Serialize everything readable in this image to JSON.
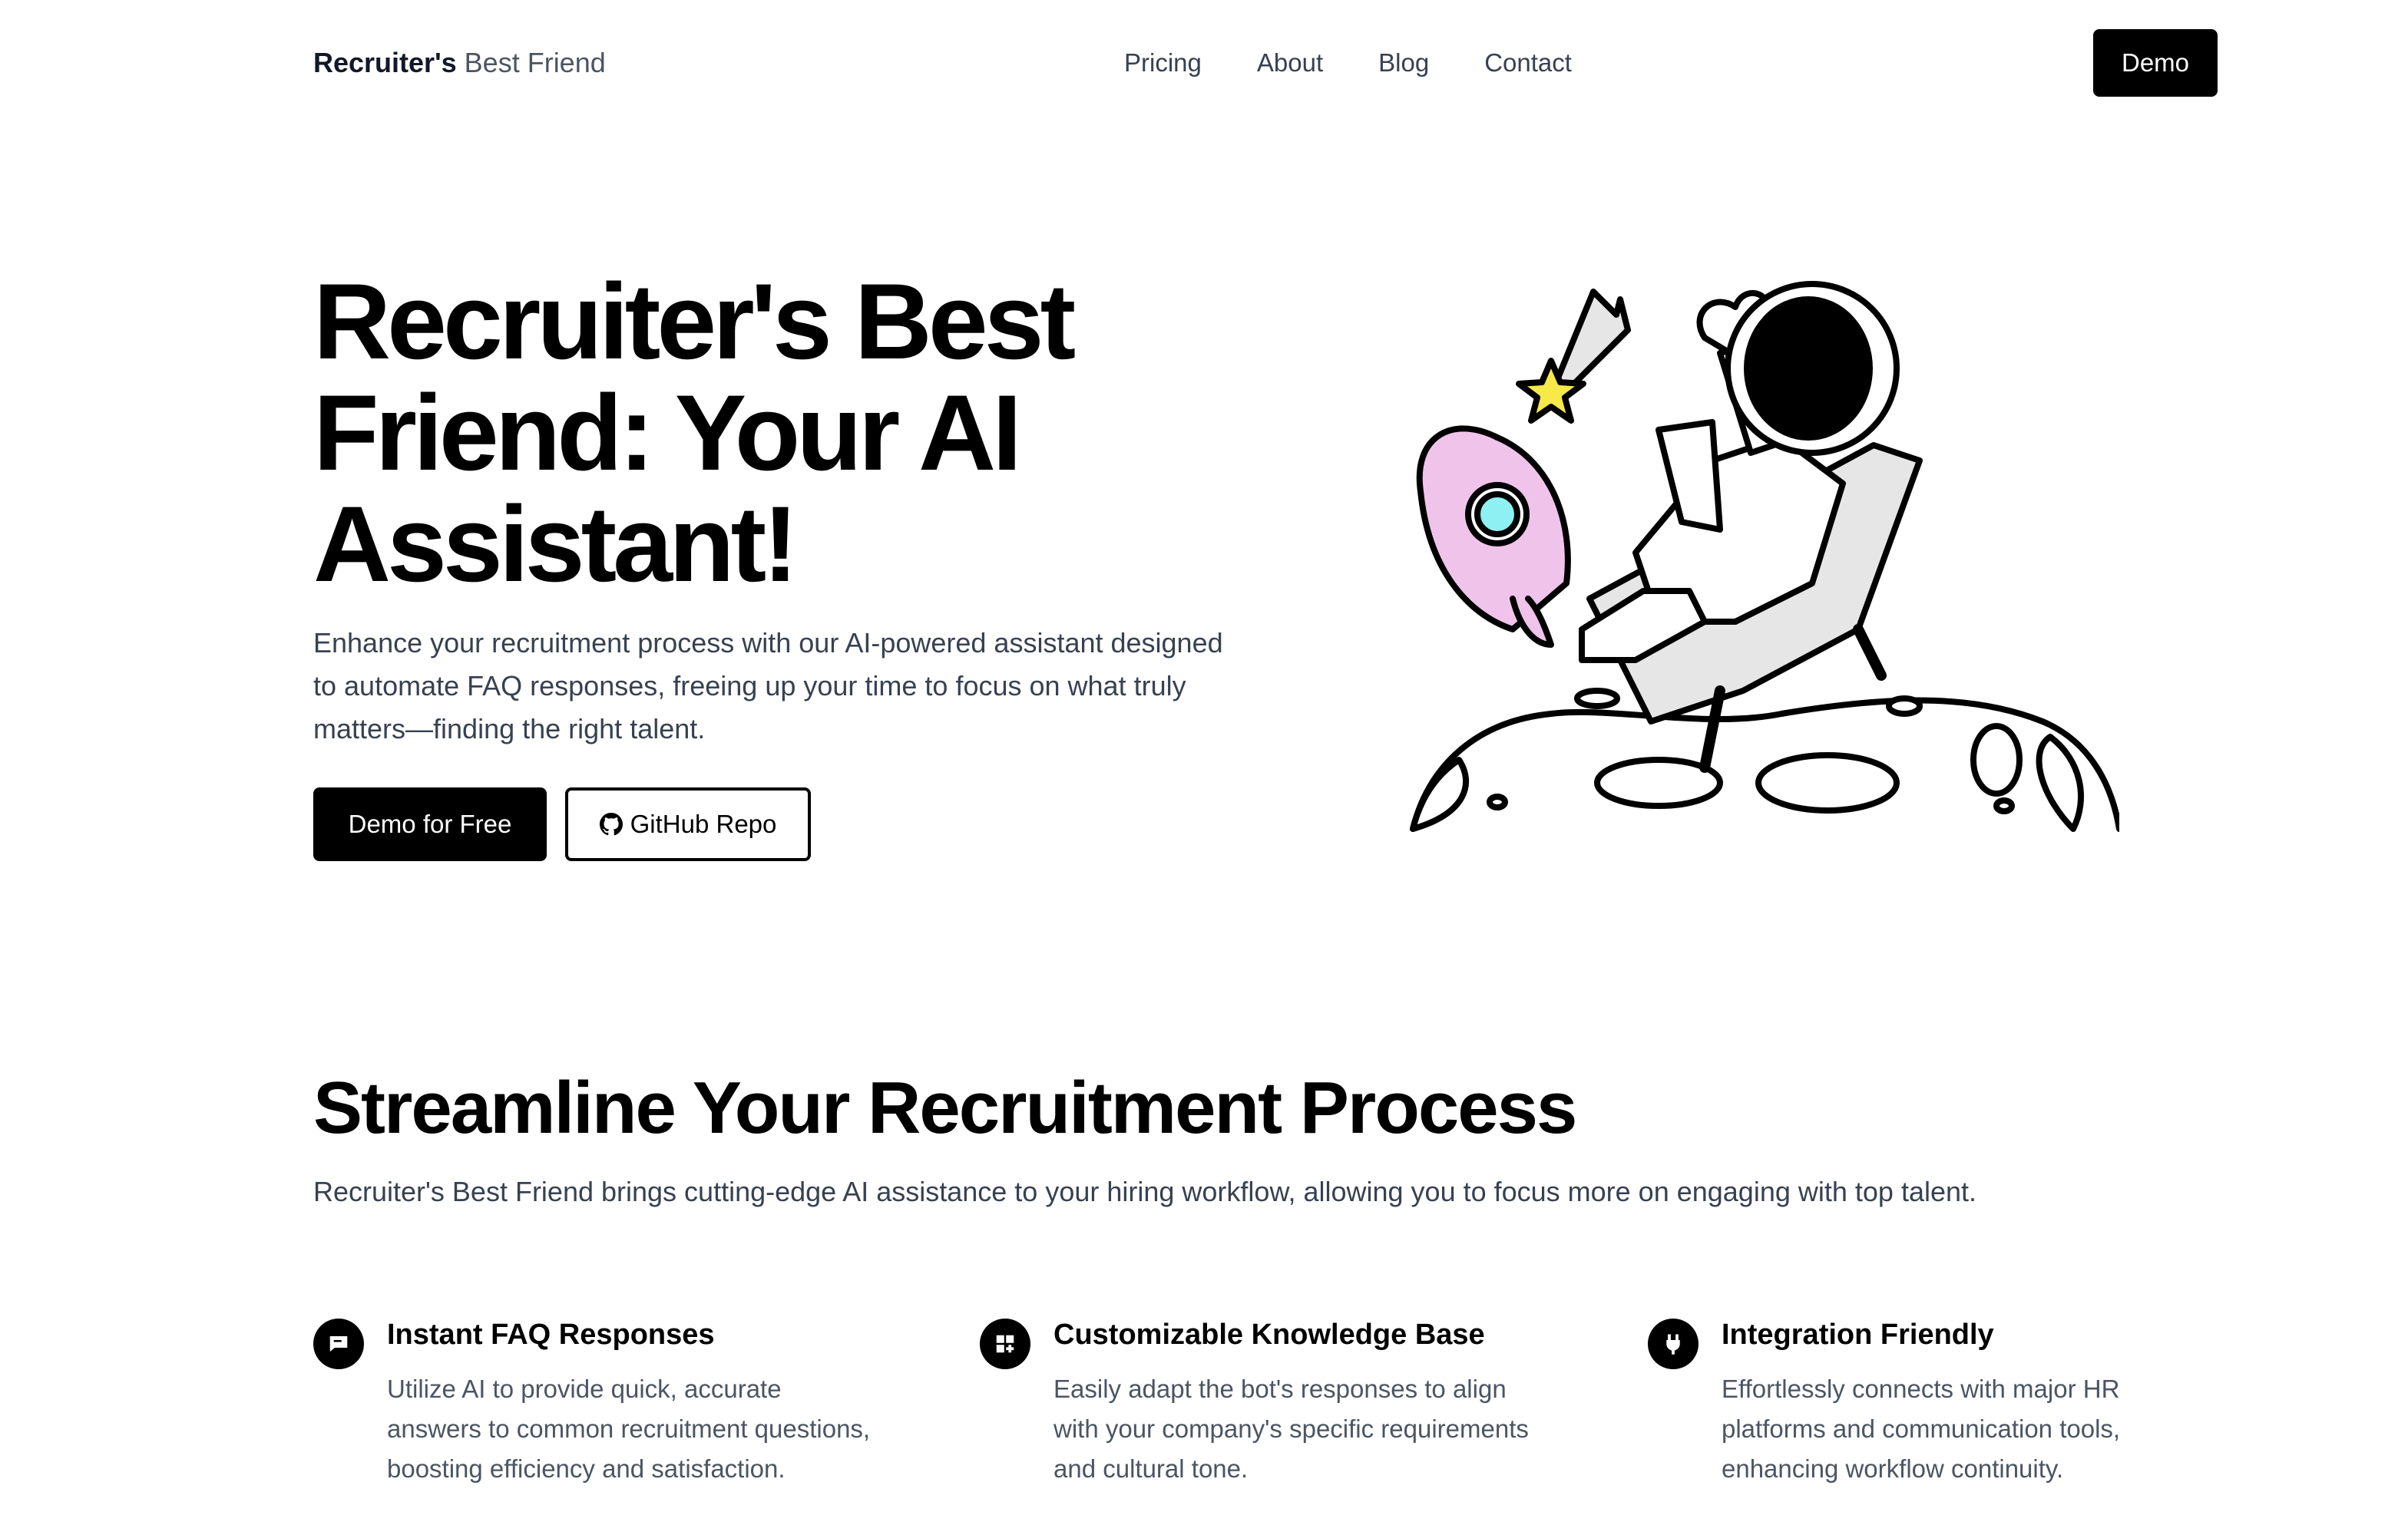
{
  "header": {
    "brand_bold": "Recruiter's",
    "brand_light": "Best Friend",
    "nav": [
      "Pricing",
      "About",
      "Blog",
      "Contact"
    ],
    "demo_label": "Demo"
  },
  "hero": {
    "title": "Recruiter's Best Friend: Your AI Assistant!",
    "subtitle": "Enhance your recruitment process with our AI-powered assistant designed to automate FAQ responses, freeing up your time to focus on what truly matters—finding the right talent.",
    "primary_button": "Demo for Free",
    "secondary_button": "GitHub Repo",
    "secondary_icon": "github-icon",
    "illustration": "astronaut-relaxing-on-moon-with-rocket-and-star"
  },
  "features_section": {
    "title": "Streamline Your Recruitment Process",
    "subtitle": "Recruiter's Best Friend brings cutting-edge AI assistance to your hiring workflow, allowing you to focus more on engaging with top talent.",
    "items": [
      {
        "icon": "chat-bubble-icon",
        "title": "Instant FAQ Responses",
        "description": "Utilize AI to provide quick, accurate answers to common recruitment questions, boosting efficiency and satisfaction."
      },
      {
        "icon": "grid-plus-icon",
        "title": "Customizable Knowledge Base",
        "description": "Easily adapt the bot's responses to align with your company's specific requirements and cultural tone."
      },
      {
        "icon": "plug-icon",
        "title": "Integration Friendly",
        "description": "Effortlessly connects with major HR platforms and communication tools, enhancing workflow continuity."
      }
    ]
  },
  "colors": {
    "primary": "#000000",
    "text_muted": "#374151",
    "accent_pink": "#f0c4ea",
    "accent_cyan": "#8ef0f2",
    "accent_yellow": "#f7e94a"
  }
}
